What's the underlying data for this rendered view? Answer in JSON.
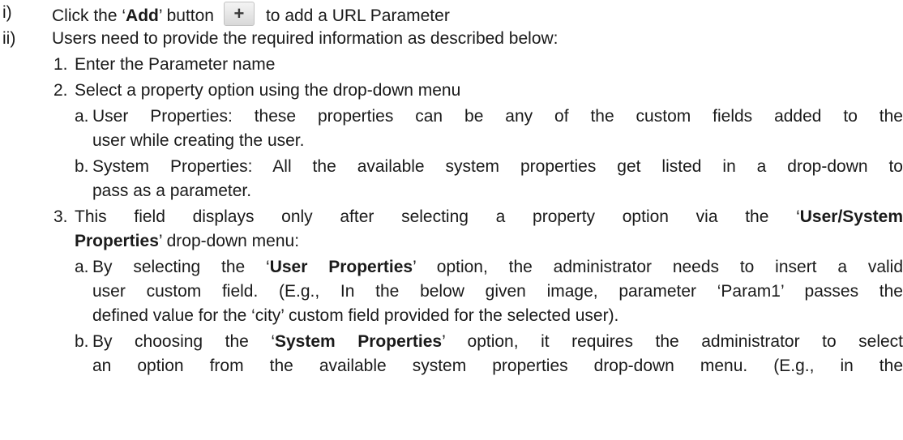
{
  "steps": {
    "i": {
      "label": "i)",
      "pre": "Click the ‘",
      "add_word": "Add",
      "mid": "’ button",
      "button_icon": "plus-icon",
      "button_glyph": "+",
      "post": "to add a URL Parameter"
    },
    "ii": {
      "label": "ii)",
      "text": "Users need to provide the required information as described below:",
      "items": {
        "n1": {
          "label": "1.",
          "text": "Enter the Parameter name"
        },
        "n2": {
          "label": "2.",
          "text": "Select a property option using the drop-down menu",
          "a": {
            "label": "a.",
            "line1": "User Properties: these properties can be any of the custom fields added to the",
            "line2": "user while creating the user."
          },
          "b": {
            "label": "b.",
            "line1": "System Properties: All the available system properties get listed in a drop-down to",
            "line2": "pass as a parameter."
          }
        },
        "n3": {
          "label": "3.",
          "line1_pre": "This field displays only after selecting a property option via the ‘",
          "line1_bold": "User/System",
          "line2_bold": "Properties",
          "line2_post": "’ drop-down menu:",
          "a": {
            "label": "a.",
            "line1_pre": "By selecting the ‘",
            "line1_bold": "User Properties",
            "line1_post": "’ option, the administrator needs to insert a valid",
            "line2": "user custom field. (E.g., In the below given image, parameter ‘Param1’ passes the",
            "line3": "defined value for the ‘city’ custom field provided for the selected user)."
          },
          "b": {
            "label": "b.",
            "line1_pre": "By choosing the ‘",
            "line1_bold": "System Properties",
            "line1_post": "’ option, it requires the administrator to select",
            "line2": "an option from the available system properties drop-down menu. (E.g., in the"
          }
        }
      }
    }
  }
}
